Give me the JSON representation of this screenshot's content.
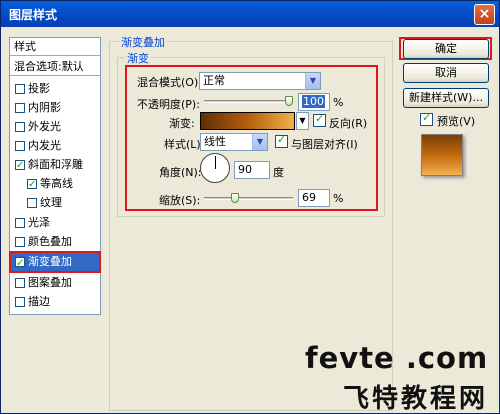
{
  "window": {
    "title": "图层样式",
    "close_glyph": "×"
  },
  "sidebar": {
    "header": "样式",
    "blend_options": "混合选项:默认",
    "items": [
      {
        "label": "投影",
        "checked": false
      },
      {
        "label": "内阴影",
        "checked": false
      },
      {
        "label": "外发光",
        "checked": false
      },
      {
        "label": "内发光",
        "checked": false
      },
      {
        "label": "斜面和浮雕",
        "checked": true
      },
      {
        "label": "等高线",
        "checked": true
      },
      {
        "label": "纹理",
        "checked": false
      },
      {
        "label": "光泽",
        "checked": false
      },
      {
        "label": "颜色叠加",
        "checked": false
      },
      {
        "label": "渐变叠加",
        "checked": true,
        "selected": true
      },
      {
        "label": "图案叠加",
        "checked": false
      },
      {
        "label": "描边",
        "checked": false
      }
    ]
  },
  "panel": {
    "group_title": "渐变叠加",
    "subgroup_title": "渐变",
    "blend_mode_label": "混合模式(O):",
    "blend_mode_value": "正常",
    "opacity_label": "不透明度(P):",
    "opacity_value": "100",
    "opacity_percent": 100,
    "percent_sign": "%",
    "gradient_label": "渐变:",
    "reverse_label": "反向(R)",
    "reverse_checked": true,
    "style_label": "样式(L):",
    "style_value": "线性",
    "align_label": "与图层对齐(I)",
    "align_checked": true,
    "angle_label": "角度(N):",
    "angle_value": "90",
    "angle_unit": "度",
    "scale_label": "缩放(S):",
    "scale_value": "69",
    "scale_percent": 69
  },
  "buttons": {
    "ok": "确定",
    "cancel": "取消",
    "new_style": "新建样式(W)...",
    "preview_label": "预览(V)",
    "preview_checked": true
  },
  "watermark": {
    "line1": "fevte .com",
    "line2": "飞特教程网"
  },
  "colors": {
    "highlight_red": "#e0161b",
    "selection_blue": "#316ac5",
    "gradient_dark": "#5e2f05",
    "gradient_light": "#f0b24a"
  }
}
